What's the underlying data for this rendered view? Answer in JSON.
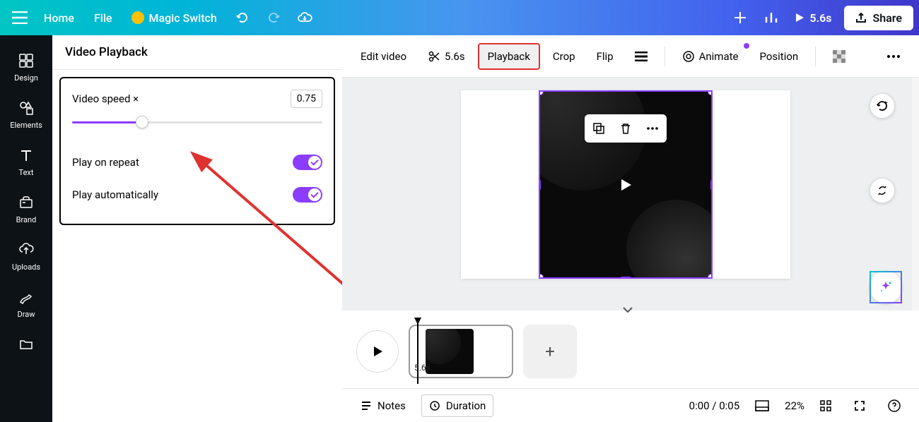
{
  "header": {
    "home": "Home",
    "file": "File",
    "magic_switch": "Magic Switch",
    "duration": "5.6s",
    "share": "Share"
  },
  "sidebar": {
    "items": [
      {
        "label": "Design"
      },
      {
        "label": "Elements"
      },
      {
        "label": "Text"
      },
      {
        "label": "Brand"
      },
      {
        "label": "Uploads"
      },
      {
        "label": "Draw"
      }
    ]
  },
  "panel": {
    "title": "Video Playback",
    "speed_label": "Video speed ×",
    "speed_value": "0.75",
    "slider_percent": 28,
    "repeat_label": "Play on repeat",
    "auto_label": "Play automatically"
  },
  "toolbar": {
    "edit_video": "Edit video",
    "trim_duration": "5.6s",
    "playback": "Playback",
    "crop": "Crop",
    "flip": "Flip",
    "animate": "Animate",
    "position": "Position"
  },
  "timeline": {
    "clip_duration": "5.6s"
  },
  "bottom": {
    "notes": "Notes",
    "duration": "Duration",
    "time": "0:00 / 0:05",
    "zoom": "22%"
  }
}
